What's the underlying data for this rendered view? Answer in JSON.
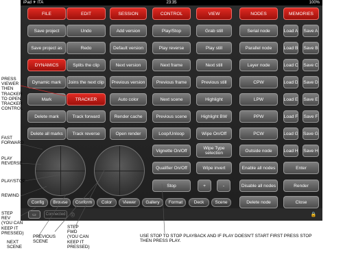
{
  "status": {
    "carrier": "iPad ✈ ITA",
    "time": "23:35",
    "battery": "100%"
  },
  "headers": {
    "file": "FILE",
    "edit": "EDIT",
    "session": "SESSION",
    "control": "CONTROL",
    "view": "VIEW",
    "nodes": "NODES",
    "memories": "MEMORIES"
  },
  "file": [
    "Save project",
    "Save project as",
    "DYNAMICS",
    "Dynamic mark",
    "Mark",
    "Delete mark",
    "Delete all marks"
  ],
  "edit": [
    "Undo",
    "Redo",
    "Splits the clip",
    "Joins the next clip",
    "TRACKER",
    "Track forward",
    "Track reverse"
  ],
  "session": [
    "Add version",
    "Default version",
    "Next version",
    "Previous version",
    "Auto color",
    "Render cache",
    "Open render"
  ],
  "control": [
    "Play/Stop",
    "Play reverse",
    "Next frame",
    "Previous frame",
    "Next scene",
    "Previous scene",
    "Loop/Unloop",
    "Vignette On/Off",
    "Qualifier On/Off",
    "Stop"
  ],
  "view": [
    "Grab still",
    "Play still",
    "Next still",
    "Previous still",
    "Highlight",
    "Highlight BW",
    "Wipe On/Off",
    "Wipe Type selection",
    "Wipe invert",
    "+",
    "-"
  ],
  "nodes": [
    "Serial node",
    "Parallel node",
    "Layer node",
    "CPW",
    "LPW",
    "PPW",
    "PCW",
    "Outside node",
    "Enable all nodes",
    "Disable all nodes",
    "Delete node"
  ],
  "memories": [
    "Load A",
    "Save A",
    "Load B",
    "Save B",
    "Load C",
    "Save C",
    "Load D",
    "Save D",
    "Load E",
    "Save E",
    "Load F",
    "Save F",
    "Load G",
    "Save G",
    "Load H",
    "Save H"
  ],
  "memory_actions": [
    "Enter",
    "Render",
    "Close"
  ],
  "tabs": [
    "Config",
    "Browse",
    "Conform",
    "Color",
    "Viewer",
    "Gallery",
    "Format",
    "Deck",
    "Scene"
  ],
  "bottom": {
    "small_label": "Connected",
    "lock_glyph": "🔒"
  },
  "annotations": {
    "press_viewer": "PRESS\nVIEWER\nTHEN\nTRACKER\nTO OPEN\nTRACKER\nCONTROL",
    "fast_forward": "FAST\nFORWARD",
    "play_reverse": "PLAY\nREVERSE",
    "play_stop": "PLAY/STOP",
    "rewind": "REWIND",
    "step_rev": "STEP\nREV\n(YOU CAN\nKEEP IT\nPRESSED)",
    "next_scene": "NEXT\nSCENE",
    "previous_scene": "PREVIOUS\nSCENE",
    "step_fwd": "STEP\nFWD\n(YOU CAN\nKEEP IT\nPRESSED)",
    "note": "USE STOP TO STOP PLAYBACK AND IF PLAY DOESN'T START FIRST PRESS STOP\nTHEN PRESS PLAY."
  }
}
